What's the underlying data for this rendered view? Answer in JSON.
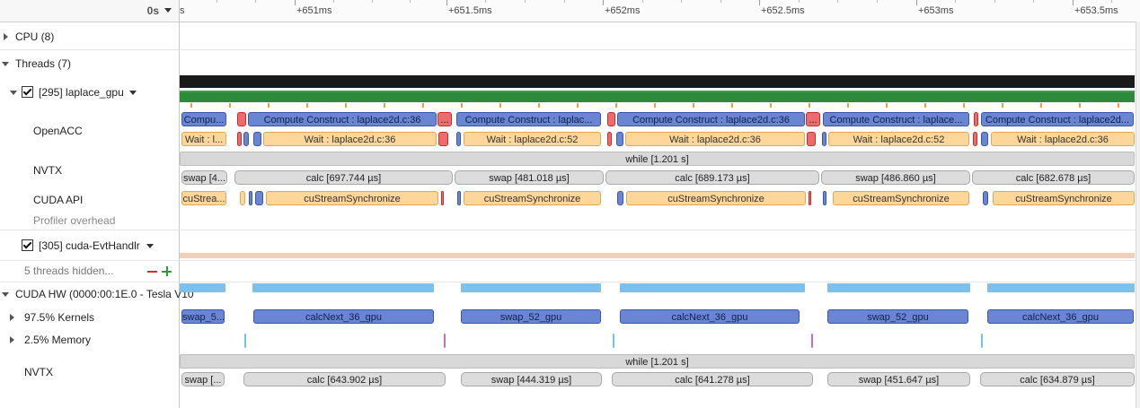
{
  "timeline": {
    "origin_label": "0s",
    "ticks": [
      "+651ms",
      "+651.5ms",
      "+652ms",
      "+652.5ms",
      "+653ms",
      "+653.5ms"
    ]
  },
  "tree": {
    "cpu": "CPU (8)",
    "threads": "Threads (7)",
    "thread1": "[295] laplace_gpu",
    "openacc": "OpenACC",
    "nvtx1": "NVTX",
    "cuda_api": "CUDA API",
    "profiler_overhead": "Profiler overhead",
    "thread2": "[305] cuda-EvtHandlr",
    "hidden": "5 threads hidden...",
    "cuda_hw": "CUDA HW (0000:00:1E.0 - Tesla V10",
    "kernels": "97.5% Kernels",
    "memory": "2.5% Memory",
    "nvtx2": "NVTX"
  },
  "openacc_top": [
    "Compu...",
    "Compute Construct : laplace2d.c:36",
    "...",
    "Compute Construct : laplac...",
    "Compute Construct : laplace2d.c:36",
    "...",
    "Compute Construct : laplace...",
    "Compute Construct : laplace2d..."
  ],
  "openacc_bottom": [
    "Wait : l...",
    "Wait : laplace2d.c:36",
    "Wait : laplace2d.c:52",
    "Wait : laplace2d.c:36",
    "Wait : laplace2d.c:52",
    "Wait : laplace2d.c:36"
  ],
  "nvtx_while": "while [1.201 s]",
  "nvtx_top": [
    "swap [4...",
    "calc [697.744 µs]",
    "swap [481.018 µs]",
    "calc [689.173 µs]",
    "swap [486.860 µs]",
    "calc [682.678 µs]"
  ],
  "cuda_api": [
    "cuStrea...",
    "cuStreamSynchronize",
    "cuStreamSynchronize",
    "cuStreamSynchronize",
    "cuStreamSynchronize",
    "cuStreamSynchronize"
  ],
  "kernels": [
    "swap_5...",
    "calcNext_36_gpu",
    "swap_52_gpu",
    "calcNext_36_gpu",
    "swap_52_gpu",
    "calcNext_36_gpu"
  ],
  "nvtx_hw_while": "while [1.201 s]",
  "nvtx_hw": [
    "swap [...",
    "calc [643.902 µs]",
    "swap [444.319 µs]",
    "calc [641.278 µs]",
    "swap [451.647 µs]",
    "calc [634.879 µs]"
  ],
  "colors": {
    "blue": "#6a86d2",
    "orange": "#fdd79a",
    "gray": "#dcdcdc",
    "red": "#ef6b6b",
    "light_blue": "#7cc0ee",
    "green": "#2d8a3a",
    "black": "#1a1a1a",
    "salmon": "#f8cdb8"
  }
}
